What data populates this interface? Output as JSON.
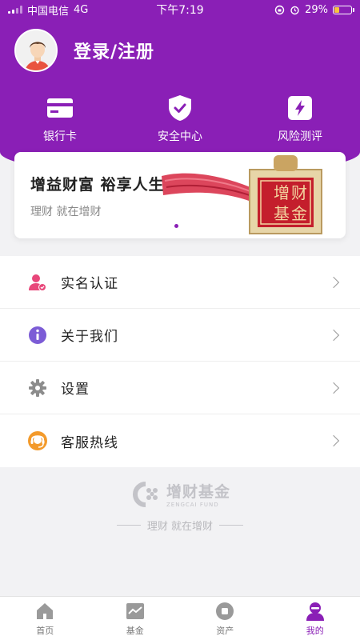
{
  "status_bar": {
    "carrier": "中国电信",
    "network": "4G",
    "time": "下午7:19",
    "battery": "29%",
    "battery_level": 0.29
  },
  "profile": {
    "login_label": "登录/注册",
    "avatar_icon": "user-avatar-icon"
  },
  "shortcuts": [
    {
      "label": "银行卡",
      "icon": "bank-card-icon"
    },
    {
      "label": "安全中心",
      "icon": "shield-check-icon"
    },
    {
      "label": "风险测评",
      "icon": "lightning-icon"
    }
  ],
  "banner": {
    "title": "增益财富 裕享人生",
    "subtitle": "理财 就在增财",
    "seal_text": [
      "增",
      "财",
      "基",
      "金"
    ]
  },
  "menu": [
    {
      "label": "实名认证",
      "icon": "user-verify-icon"
    },
    {
      "label": "关于我们",
      "icon": "info-icon"
    },
    {
      "label": "设置",
      "icon": "gear-icon"
    },
    {
      "label": "客服热线",
      "icon": "headset-icon"
    }
  ],
  "brand": {
    "name": "增财基金",
    "english": "ZENGCAI FUND",
    "slogan": "理财 就在增财"
  },
  "tabbar": [
    {
      "label": "首页",
      "icon": "home-icon",
      "active": false
    },
    {
      "label": "基金",
      "icon": "fund-chart-icon",
      "active": false
    },
    {
      "label": "资产",
      "icon": "asset-icon",
      "active": false
    },
    {
      "label": "我的",
      "icon": "profile-icon",
      "active": true
    }
  ],
  "colors": {
    "brand_purple": "#8a1fb6",
    "battery_yellow": "#f6c43d"
  }
}
